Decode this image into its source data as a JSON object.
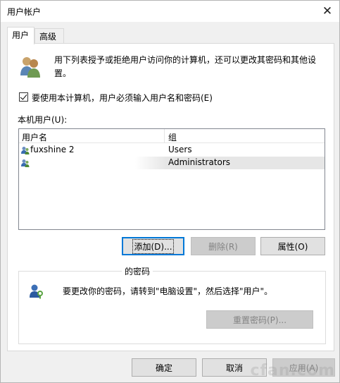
{
  "window": {
    "title": "用户帐户",
    "close_glyph": "✕"
  },
  "tabs": [
    {
      "label": "用户",
      "active": true
    },
    {
      "label": "高级",
      "active": false
    }
  ],
  "users_tab": {
    "intro_text": "用下列表授予或拒绝用户访问你的计算机，还可以更改其密码和其他设置。",
    "require_login_checkbox": {
      "label": "要使用本计算机，用户必须输入用户名和密码(E)",
      "checked": true
    },
    "local_users_label": "本机用户(U):",
    "columns": [
      "用户名",
      "组"
    ],
    "rows": [
      {
        "name": "fuxshine 2",
        "group": "Users",
        "selected": false
      },
      {
        "name": "",
        "group": "Administrators",
        "selected": true
      }
    ],
    "buttons": {
      "add": "添加(D)...",
      "remove": "删除(R)",
      "properties": "属性(O)"
    },
    "password_group": {
      "legend": "的密码",
      "text": "要更改你的密码，请转到\"电脑设置\"，然后选择\"用户\"。",
      "reset_button": "重置密码(P)..."
    }
  },
  "footer_buttons": {
    "ok": "确定",
    "cancel": "取消",
    "apply": "应用(A)"
  },
  "watermark": "cfan.com",
  "icons": {
    "users": "users-icon",
    "user_row": "user-icon",
    "password": "user-key-icon"
  }
}
